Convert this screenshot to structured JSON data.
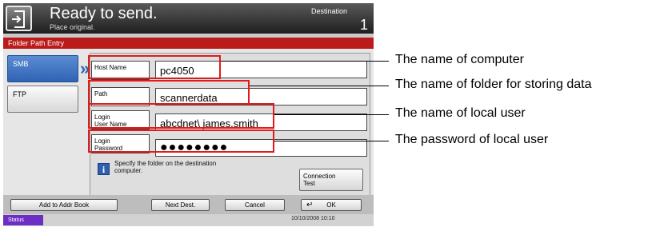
{
  "header": {
    "title": "Ready to send.",
    "subtitle": "Place original.",
    "destination_label": "Destination",
    "destination_count": "1"
  },
  "section_title": "Folder Path Entry",
  "tabs": [
    {
      "label": "SMB",
      "selected": true
    },
    {
      "label": "FTP",
      "selected": false
    }
  ],
  "fields": {
    "host": {
      "label": "Host Name",
      "value": "pc4050"
    },
    "path": {
      "label": "Path",
      "value": "scannerdata"
    },
    "user": {
      "label_line1": "Login",
      "label_line2": "User Name",
      "value": "abcdnet\\ james.smith"
    },
    "password": {
      "label_line1": "Login",
      "label_line2": "Password",
      "value": "●●●●●●●●"
    }
  },
  "info": {
    "icon": "info-icon",
    "text_line1": "Specify the folder on the destination",
    "text_line2": "computer."
  },
  "connection_test": {
    "line1": "Connection",
    "line2": "Test"
  },
  "footer": {
    "add_to_addr_book": "Add to Addr Book",
    "next_dest": "Next Dest.",
    "cancel": "Cancel",
    "ok": "OK",
    "enter_icon": "↵"
  },
  "status": {
    "label": "Status",
    "datetime": "10/10/2008   10:10"
  },
  "callouts": [
    {
      "text": "The name of computer"
    },
    {
      "text": "The name of folder for storing data"
    },
    {
      "text": "The name of local user"
    },
    {
      "text": "The password of local user"
    }
  ],
  "colors": {
    "highlight": "#e11b1b",
    "accent_blue": "#2f63b3",
    "title_bar_red": "#bb1b1b",
    "status_purple": "#6d2ec4"
  }
}
